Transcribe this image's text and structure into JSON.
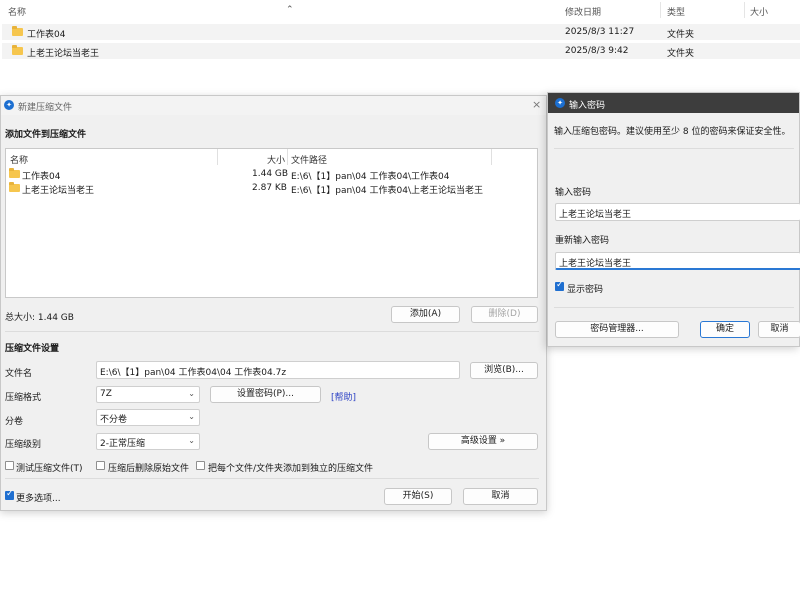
{
  "explorer": {
    "headers": {
      "name": "名称",
      "modified": "修改日期",
      "type": "类型",
      "size": "大小"
    },
    "rows": [
      {
        "name": "工作表04",
        "date": "2025/8/3 11:27",
        "type": "文件夹"
      },
      {
        "name": "上老王论坛当老王",
        "date": "2025/8/3 9:42",
        "type": "文件夹"
      }
    ]
  },
  "main_dialog": {
    "title": "新建压缩文件",
    "close_glyph": "×",
    "add_section": "添加文件到压缩文件",
    "list_headers": {
      "name": "名称",
      "size": "大小",
      "path": "文件路径"
    },
    "files": [
      {
        "name": "工作表04",
        "size": "1.44 GB",
        "path": "E:\\6\\【1】pan\\04 工作表04\\工作表04"
      },
      {
        "name": "上老王论坛当老王",
        "size": "2.87 KB",
        "path": "E:\\6\\【1】pan\\04 工作表04\\上老王论坛当老王"
      }
    ],
    "total_size": "总大小: 1.44 GB",
    "add_button": "添加(A)",
    "delete_button": "删除(D)",
    "settings_section": "压缩文件设置",
    "filename_label": "文件名",
    "filename_value": "E:\\6\\【1】pan\\04 工作表04\\04 工作表04.7z",
    "browse_button": "浏览(B)...",
    "format_label": "压缩格式",
    "format_value": "7Z",
    "set_password_button": "设置密码(P)...",
    "help_link": "[帮助]",
    "split_label": "分卷",
    "split_value": "不分卷",
    "level_label": "压缩级别",
    "level_value": "2-正常压缩",
    "advanced_button": "高级设置 »",
    "test_archive": "测试压缩文件(T)",
    "delete_after": "压缩后删除原始文件",
    "each_separate": "把每个文件/文件夹添加到独立的压缩文件",
    "more_options": "更多选项...",
    "start_button": "开始(S)",
    "cancel_button": "取消"
  },
  "password_dialog": {
    "title": "输入密码",
    "hint": "输入压缩包密码。建议使用至少 8 位的密码来保证安全性。",
    "password_label": "输入密码",
    "password_value": "上老王论坛当老王",
    "reenter_label": "重新输入密码",
    "reenter_value": "上老王论坛当老王",
    "show_password": "显示密码",
    "manager_button": "密码管理器...",
    "ok_button": "确定",
    "cancel_button": "取消"
  }
}
